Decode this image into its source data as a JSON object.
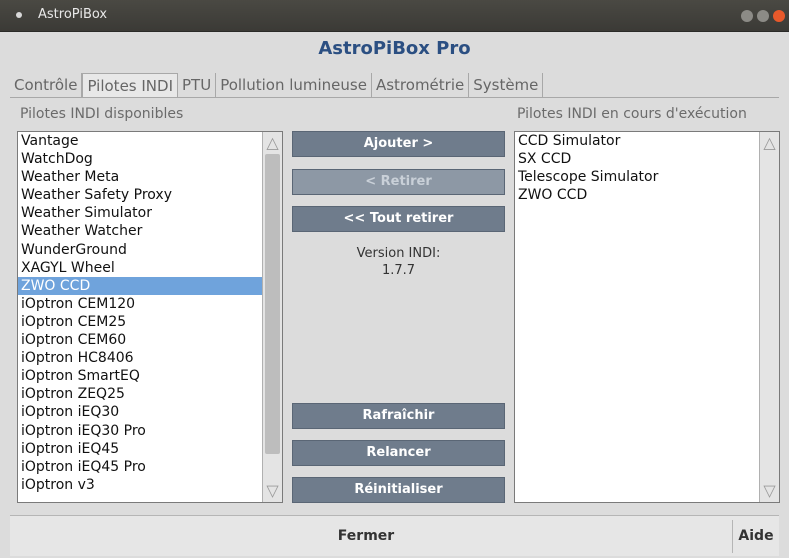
{
  "window": {
    "title": "AstroPiBox"
  },
  "app": {
    "title": "AstroPiBox Pro"
  },
  "tabs": [
    {
      "label": "Contrôle",
      "active": false
    },
    {
      "label": "Pilotes INDI",
      "active": true
    },
    {
      "label": "PTU",
      "active": false
    },
    {
      "label": "Pollution lumineuse",
      "active": false
    },
    {
      "label": "Astrométrie",
      "active": false
    },
    {
      "label": "Système",
      "active": false
    }
  ],
  "available": {
    "label": "Pilotes INDI disponibles",
    "items": [
      "Vantage",
      "WatchDog",
      "Weather Meta",
      "Weather Safety Proxy",
      "Weather Simulator",
      "Weather Watcher",
      "WunderGround",
      "XAGYL Wheel",
      "ZWO CCD",
      "iOptron CEM120",
      "iOptron CEM25",
      "iOptron CEM60",
      "iOptron HC8406",
      "iOptron SmartEQ",
      "iOptron ZEQ25",
      "iOptron iEQ30",
      "iOptron iEQ30 Pro",
      "iOptron iEQ45",
      "iOptron iEQ45 Pro",
      "iOptron v3"
    ],
    "selected": "ZWO CCD"
  },
  "running": {
    "label": "Pilotes INDI en cours d'exécution",
    "items": [
      "CCD Simulator",
      "SX CCD",
      "Telescope Simulator",
      "ZWO CCD"
    ]
  },
  "actions": {
    "add": "Ajouter >",
    "remove": "< Retirer",
    "remove_all": "<< Tout retirer",
    "refresh": "Rafraîchir",
    "restart": "Relancer",
    "reset": "Réinitialiser"
  },
  "version": {
    "label": "Version INDI:",
    "value": "1.7.7"
  },
  "footer": {
    "close": "Fermer",
    "help": "Aide"
  },
  "colors": {
    "accent": "#2b4f82",
    "selection": "#6fa3dc",
    "button": "#6f7c8c",
    "close": "#e9592b"
  }
}
